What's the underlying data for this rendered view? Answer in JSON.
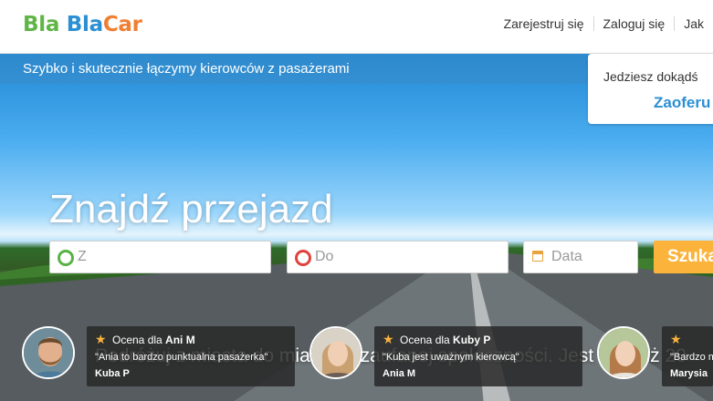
{
  "header": {
    "logo": {
      "part1": "Bla",
      "part2": "Bla",
      "part3": "Car"
    },
    "nav": [
      "Zarejestruj się",
      "Zaloguj się",
      "Jak"
    ]
  },
  "hero": {
    "tagline": "Szybko i skutecznie łączymy kierowców z pasażerami",
    "offer": {
      "question": "Jedziesz dokądś",
      "link": "Zaoferu"
    },
    "title": "Znajdź przejazd",
    "search": {
      "from_placeholder": "Z",
      "to_placeholder": "Do",
      "date_placeholder": "Data",
      "button_label": "Szuka"
    },
    "subline": "Podróżuj z miasta do miasta w zaufanej społeczności. Jest nas już 20"
  },
  "reviews": [
    {
      "rating_prefix": "Ocena dla",
      "name": "Ani M",
      "quote": "\"Ania to bardzo punktualna pasażerka\"",
      "author": "Kuba P"
    },
    {
      "rating_prefix": "Ocena dla",
      "name": "Kuby P",
      "quote": "\"Kuba jest uważnym kierowcą\"",
      "author": "Ania M"
    },
    {
      "rating_prefix": "",
      "name": "",
      "quote": "\"Bardzo m",
      "author": "Marysia"
    }
  ],
  "colors": {
    "green": "#5fb546",
    "blue": "#2b8fd3",
    "orange": "#f07f32",
    "search_button": "#fbb33c"
  }
}
